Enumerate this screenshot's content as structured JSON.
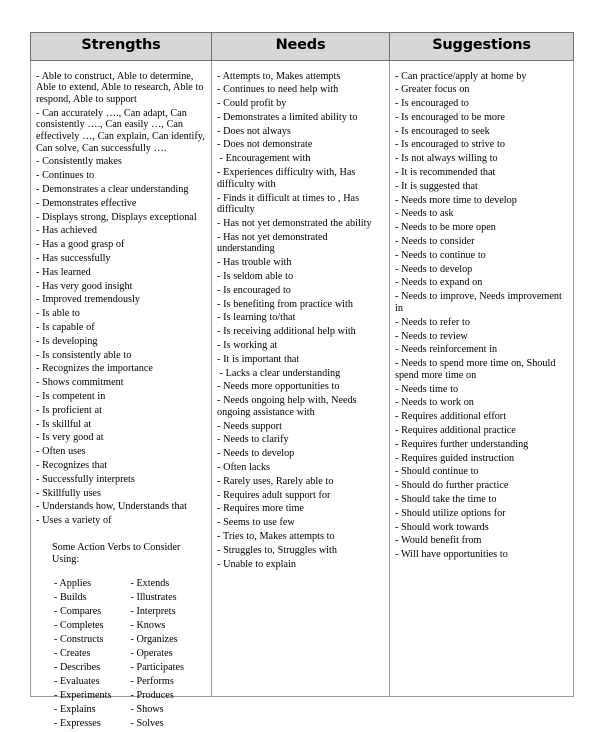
{
  "document": {
    "type": "report-card-comment-bank-table",
    "columns": 3
  },
  "table": {
    "headers": [
      "Strengths",
      "Needs",
      "Suggestions"
    ],
    "header_background": "#d6d6d6",
    "border_color": "#9b9b9b"
  },
  "strengths": {
    "items": [
      "- Able to construct, Able to determine, Able to extend, Able to research, Able to respond, Able to support",
      "- Can accurately …., Can adapt, Can consistently …., Can easily …, Can effectively …, Can explain, Can identify, Can solve, Can successfully ….",
      "- Consistently makes",
      "- Continues to",
      "- Demonstrates a clear understanding",
      "- Demonstrates effective",
      "- Displays strong, Displays exceptional",
      "- Has achieved",
      "- Has a good grasp of",
      "- Has successfully",
      "- Has learned",
      "- Has very good insight",
      "- Improved tremendously",
      "- Is able to",
      "- Is capable of",
      "- Is developing",
      "- Is consistently able to",
      "- Recognizes the importance",
      "- Shows commitment",
      "- Is competent in",
      "- Is proficient at",
      "- Is skillful at",
      "- Is very good at",
      "- Often uses",
      "- Recognizes that",
      "- Successfully interprets",
      "- Skillfully uses",
      "- Understands how, Understands that",
      "- Uses a variety of"
    ],
    "verbs_title": "Some Action Verbs to Consider Using:",
    "verbs_left": [
      "- Applies",
      "- Builds",
      "- Compares",
      "- Completes",
      "- Constructs",
      "- Creates",
      "- Describes",
      "- Evaluates",
      "- Experiments",
      "- Explains",
      "- Expresses"
    ],
    "verbs_right": [
      "- Extends",
      "- Illustrates",
      "- Interprets",
      "- Knows",
      "- Organizes",
      "- Operates",
      "- Participates",
      "- Performs",
      "- Produces",
      "- Shows",
      "- Solves"
    ]
  },
  "needs": {
    "items": [
      "- Attempts to, Makes attempts",
      "- Continues to need help with",
      "- Could profit by",
      "- Demonstrates a limited ability to",
      "- Does not always",
      "- Does not demonstrate",
      "- Encouragement with",
      "- Experiences difficulty with, Has difficulty with",
      "- Finds it difficult at times to , Has difficulty",
      "- Has not yet demonstrated the ability",
      "- Has not yet demonstrated understanding",
      "- Has trouble with",
      "- Is seldom able to",
      "- Is encouraged to",
      "- Is benefiting from practice with",
      "- Is learning to/that",
      "- Is receiving additional help with",
      "- Is working at",
      "- It is important that",
      "- Lacks a clear understanding",
      "- Needs more opportunities to",
      "- Needs ongoing help with, Needs ongoing assistance with",
      "- Needs support",
      "- Needs to clarify",
      "- Needs to develop",
      "- Often lacks",
      "- Rarely uses, Rarely able to",
      "- Requires adult support for",
      "- Requires more time",
      "- Seems to use few",
      "- Tries to, Makes attempts to",
      "- Struggles to, Struggles with",
      "- Unable to explain"
    ]
  },
  "suggestions": {
    "items": [
      "- Can practice/apply at home by",
      "- Greater focus on",
      "- Is encouraged to",
      "- Is encouraged to be more",
      "- Is encouraged to seek",
      "- Is encouraged to strive to",
      "- Is not always willing to",
      "- It is recommended that",
      "- It is suggested that",
      "- Needs more time to develop",
      "- Needs to ask",
      "- Needs to be more open",
      "- Needs to consider",
      "- Needs to continue to",
      "- Needs to develop",
      "- Needs to expand on",
      "- Needs to improve, Needs improvement in",
      "- Needs to refer to",
      "- Needs to review",
      "- Needs reinforcement in",
      "- Needs to spend more time on, Should spend more time on",
      "- Needs time to",
      "- Needs to work on",
      "- Requires additional effort",
      "- Requires additional practice",
      "- Requires further understanding",
      "- Requires guided instruction",
      "- Should continue to",
      "- Should do further practice",
      "- Should take the time to",
      "- Should utilize options for",
      "- Should work towards",
      "- Would benefit from",
      "- Will have opportunities to"
    ]
  }
}
